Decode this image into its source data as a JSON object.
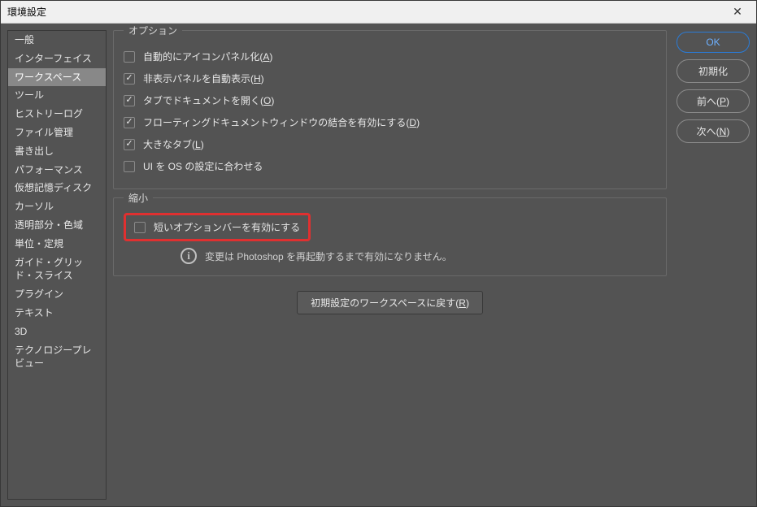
{
  "window": {
    "title": "環境設定"
  },
  "sidebar": {
    "items": [
      {
        "label": "一般"
      },
      {
        "label": "インターフェイス"
      },
      {
        "label": "ワークスペース",
        "selected": true
      },
      {
        "label": "ツール"
      },
      {
        "label": "ヒストリーログ"
      },
      {
        "label": "ファイル管理"
      },
      {
        "label": "書き出し"
      },
      {
        "label": "パフォーマンス"
      },
      {
        "label": "仮想記憶ディスク"
      },
      {
        "label": "カーソル"
      },
      {
        "label": "透明部分・色域"
      },
      {
        "label": "単位・定規"
      },
      {
        "label": "ガイド・グリッド・スライス"
      },
      {
        "label": "プラグイン"
      },
      {
        "label": "テキスト"
      },
      {
        "label": "3D"
      },
      {
        "label": "テクノロジープレビュー"
      }
    ]
  },
  "options": {
    "legend": "オプション",
    "items": [
      {
        "label": "自動的にアイコンパネル化(",
        "accel": "A",
        "suffix": ")",
        "checked": false
      },
      {
        "label": "非表示パネルを自動表示(",
        "accel": "H",
        "suffix": ")",
        "checked": true
      },
      {
        "label": "タブでドキュメントを開く(",
        "accel": "O",
        "suffix": ")",
        "checked": true
      },
      {
        "label": "フローティングドキュメントウィンドウの結合を有効にする(",
        "accel": "D",
        "suffix": ")",
        "checked": true
      },
      {
        "label": "大きなタブ(",
        "accel": "L",
        "suffix": ")",
        "checked": true
      },
      {
        "label": "UI を OS の設定に合わせる",
        "accel": "",
        "suffix": "",
        "checked": false
      }
    ]
  },
  "shrink": {
    "legend": "縮小",
    "item": {
      "label": "短いオプションバーを有効にする",
      "checked": false
    },
    "info": "変更は Photoshop を再起動するまで有効になりません。"
  },
  "reset": {
    "label": "初期設定のワークスペースに戻す(",
    "accel": "R",
    "suffix": ")"
  },
  "buttons": {
    "ok": "OK",
    "init": "初期化",
    "prev": {
      "text": "前へ(",
      "accel": "P",
      "suffix": ")"
    },
    "next": {
      "text": "次へ(",
      "accel": "N",
      "suffix": ")"
    }
  }
}
